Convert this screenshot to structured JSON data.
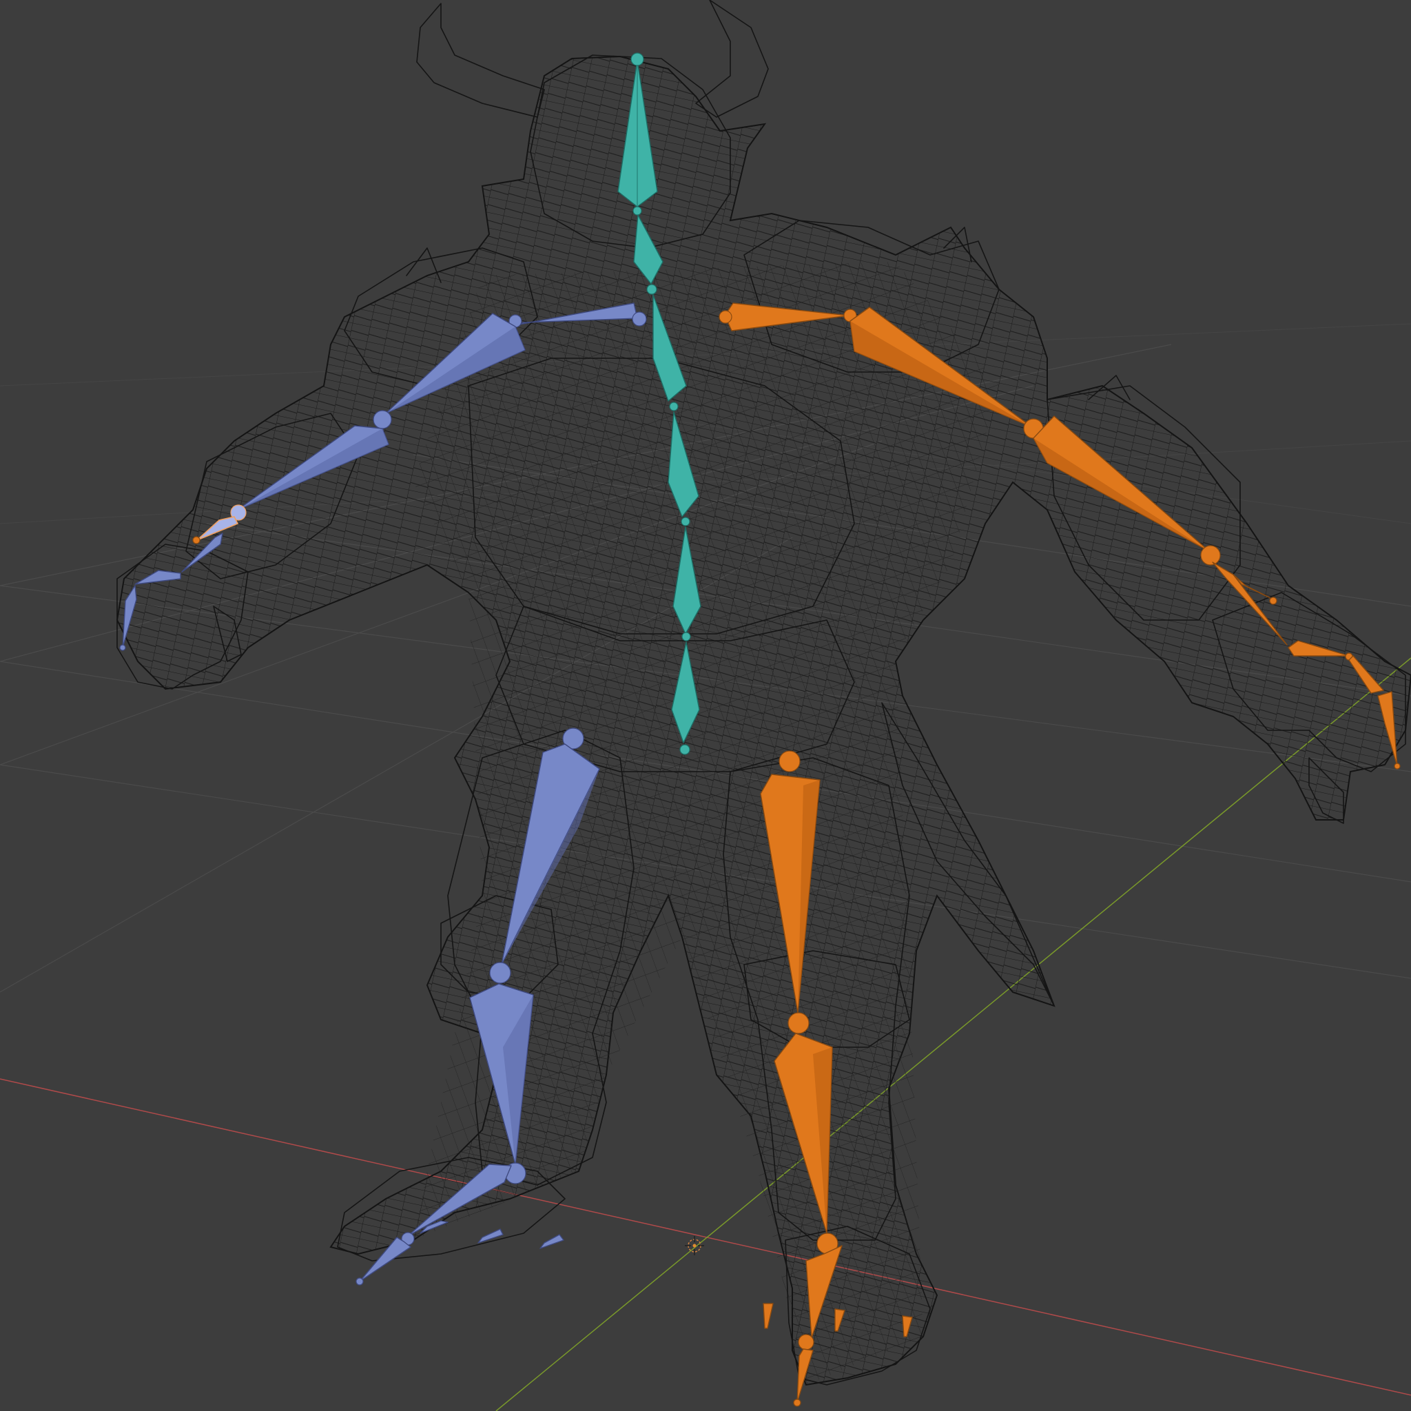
{
  "viewport": {
    "background": "#3d3d3d",
    "grid_color": "#4b4b4b",
    "x_axis_color": "#b04a4a",
    "y_axis_color": "#7a9a2a",
    "wireframe_color": "#151515"
  },
  "armature": {
    "spine_color": "#3fb3a7",
    "left_side_color": "#7788c8",
    "right_side_color": "#e0781c",
    "selected_outline_color": "#f0a060"
  },
  "icons": {
    "origin": "3d-cursor-icon"
  }
}
